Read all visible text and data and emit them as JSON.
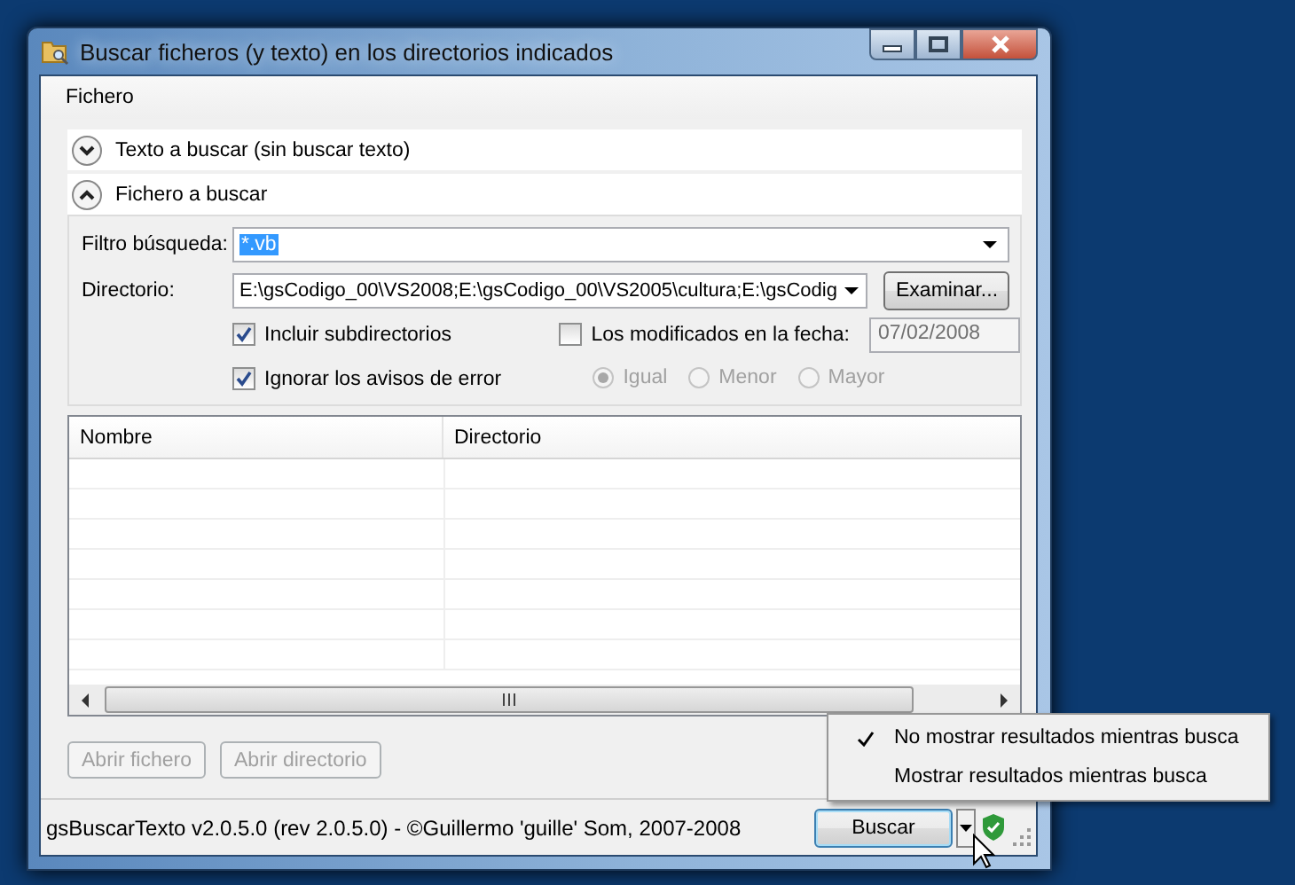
{
  "window": {
    "title": "Buscar ficheros (y texto) en los directorios indicados",
    "menu": [
      "Fichero"
    ]
  },
  "sections": [
    {
      "label": "Texto a buscar (sin buscar texto)",
      "expanded": false
    },
    {
      "label": "Fichero a buscar",
      "expanded": true
    }
  ],
  "filter": {
    "label": "Filtro búsqueda:",
    "value": "*.vb"
  },
  "directory": {
    "label": "Directorio:",
    "value": "E:\\gsCodigo_00\\VS2008;E:\\gsCodigo_00\\VS2005\\cultura;E:\\gsCodig",
    "button": "Examinar..."
  },
  "options": [
    {
      "label": "Incluir subdirectorios",
      "checked": true
    },
    {
      "label": "Ignorar los avisos de error",
      "checked": true
    }
  ],
  "date_filter": {
    "label": "Los modificados en la fecha:",
    "checked": false,
    "value": "07/02/2008",
    "disabled": true
  },
  "comparisons": [
    {
      "label": "Igual",
      "selected": true,
      "disabled": true
    },
    {
      "label": "Menor",
      "selected": false,
      "disabled": true
    },
    {
      "label": "Mayor",
      "selected": false,
      "disabled": true
    }
  ],
  "table": {
    "columns": [
      "Nombre",
      "Directorio"
    ]
  },
  "buttons": [
    {
      "label": "Abrir fichero",
      "disabled": true
    },
    {
      "label": "Abrir directorio",
      "disabled": true
    }
  ],
  "status_bar": {
    "text": "gsBuscarTexto v2.0.5.0 (rev 2.0.5.0) - ©Guillermo 'guille' Som, 2007-2008",
    "search_button": "Buscar"
  },
  "popup_menu": [
    {
      "label": "No mostrar resultados mientras busca",
      "checked": true
    },
    {
      "label": "Mostrar resultados mientras busca",
      "checked": false
    }
  ]
}
